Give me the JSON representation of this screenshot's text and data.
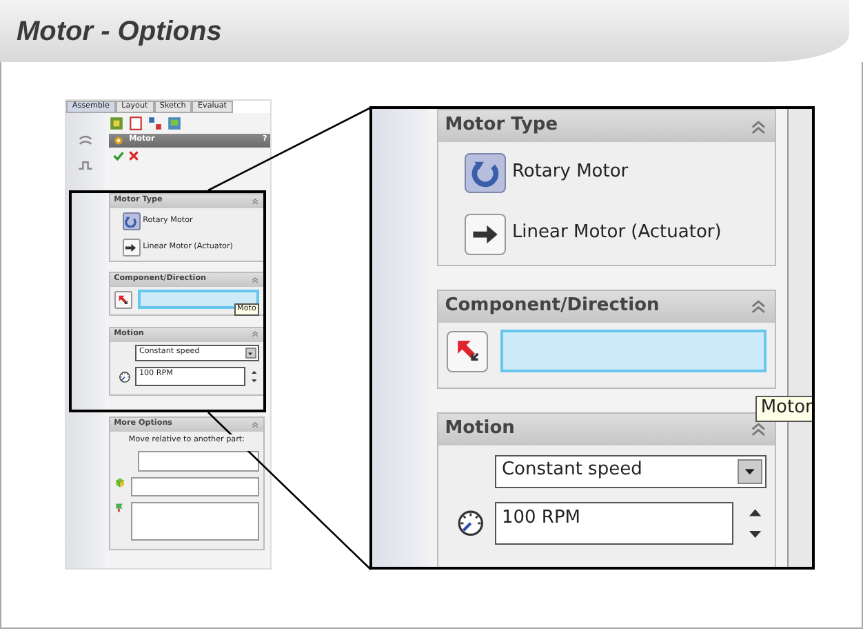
{
  "slide": {
    "title": "Motor - Options"
  },
  "panels": [
    {
      "kind": "full",
      "tabs": [
        {
          "label": "Assemble",
          "selected": true
        },
        {
          "label": "Layout",
          "selected": false
        },
        {
          "label": "Sketch",
          "selected": false
        },
        {
          "label": "Evaluat",
          "selected": false
        }
      ],
      "title": "Motor",
      "help": "?",
      "motor_type": {
        "heading": "Motor Type",
        "options": [
          {
            "label": "Rotary Motor",
            "selected": true
          },
          {
            "label": "Linear Motor (Actuator)",
            "selected": false
          }
        ]
      },
      "component_direction": {
        "heading": "Component/Direction",
        "field_active": true
      },
      "motion": {
        "heading": "Motion",
        "dropdown": "Constant speed",
        "speed": "100 RPM"
      },
      "tooltip": "Moto",
      "more_options": {
        "heading": "More Options",
        "text": "Move relative to another part:"
      }
    },
    {
      "kind": "zoom",
      "motor_type": {
        "heading": "Motor Type",
        "options": [
          {
            "label": "Rotary Motor",
            "selected": true
          },
          {
            "label": "Linear Motor (Actuator)",
            "selected": false
          }
        ]
      },
      "component_direction": {
        "heading": "Component/Direction",
        "field_active": true
      },
      "motion": {
        "heading": "Motion",
        "dropdown": "Constant speed",
        "speed": "100 RPM"
      },
      "tooltip": "Motor"
    }
  ]
}
